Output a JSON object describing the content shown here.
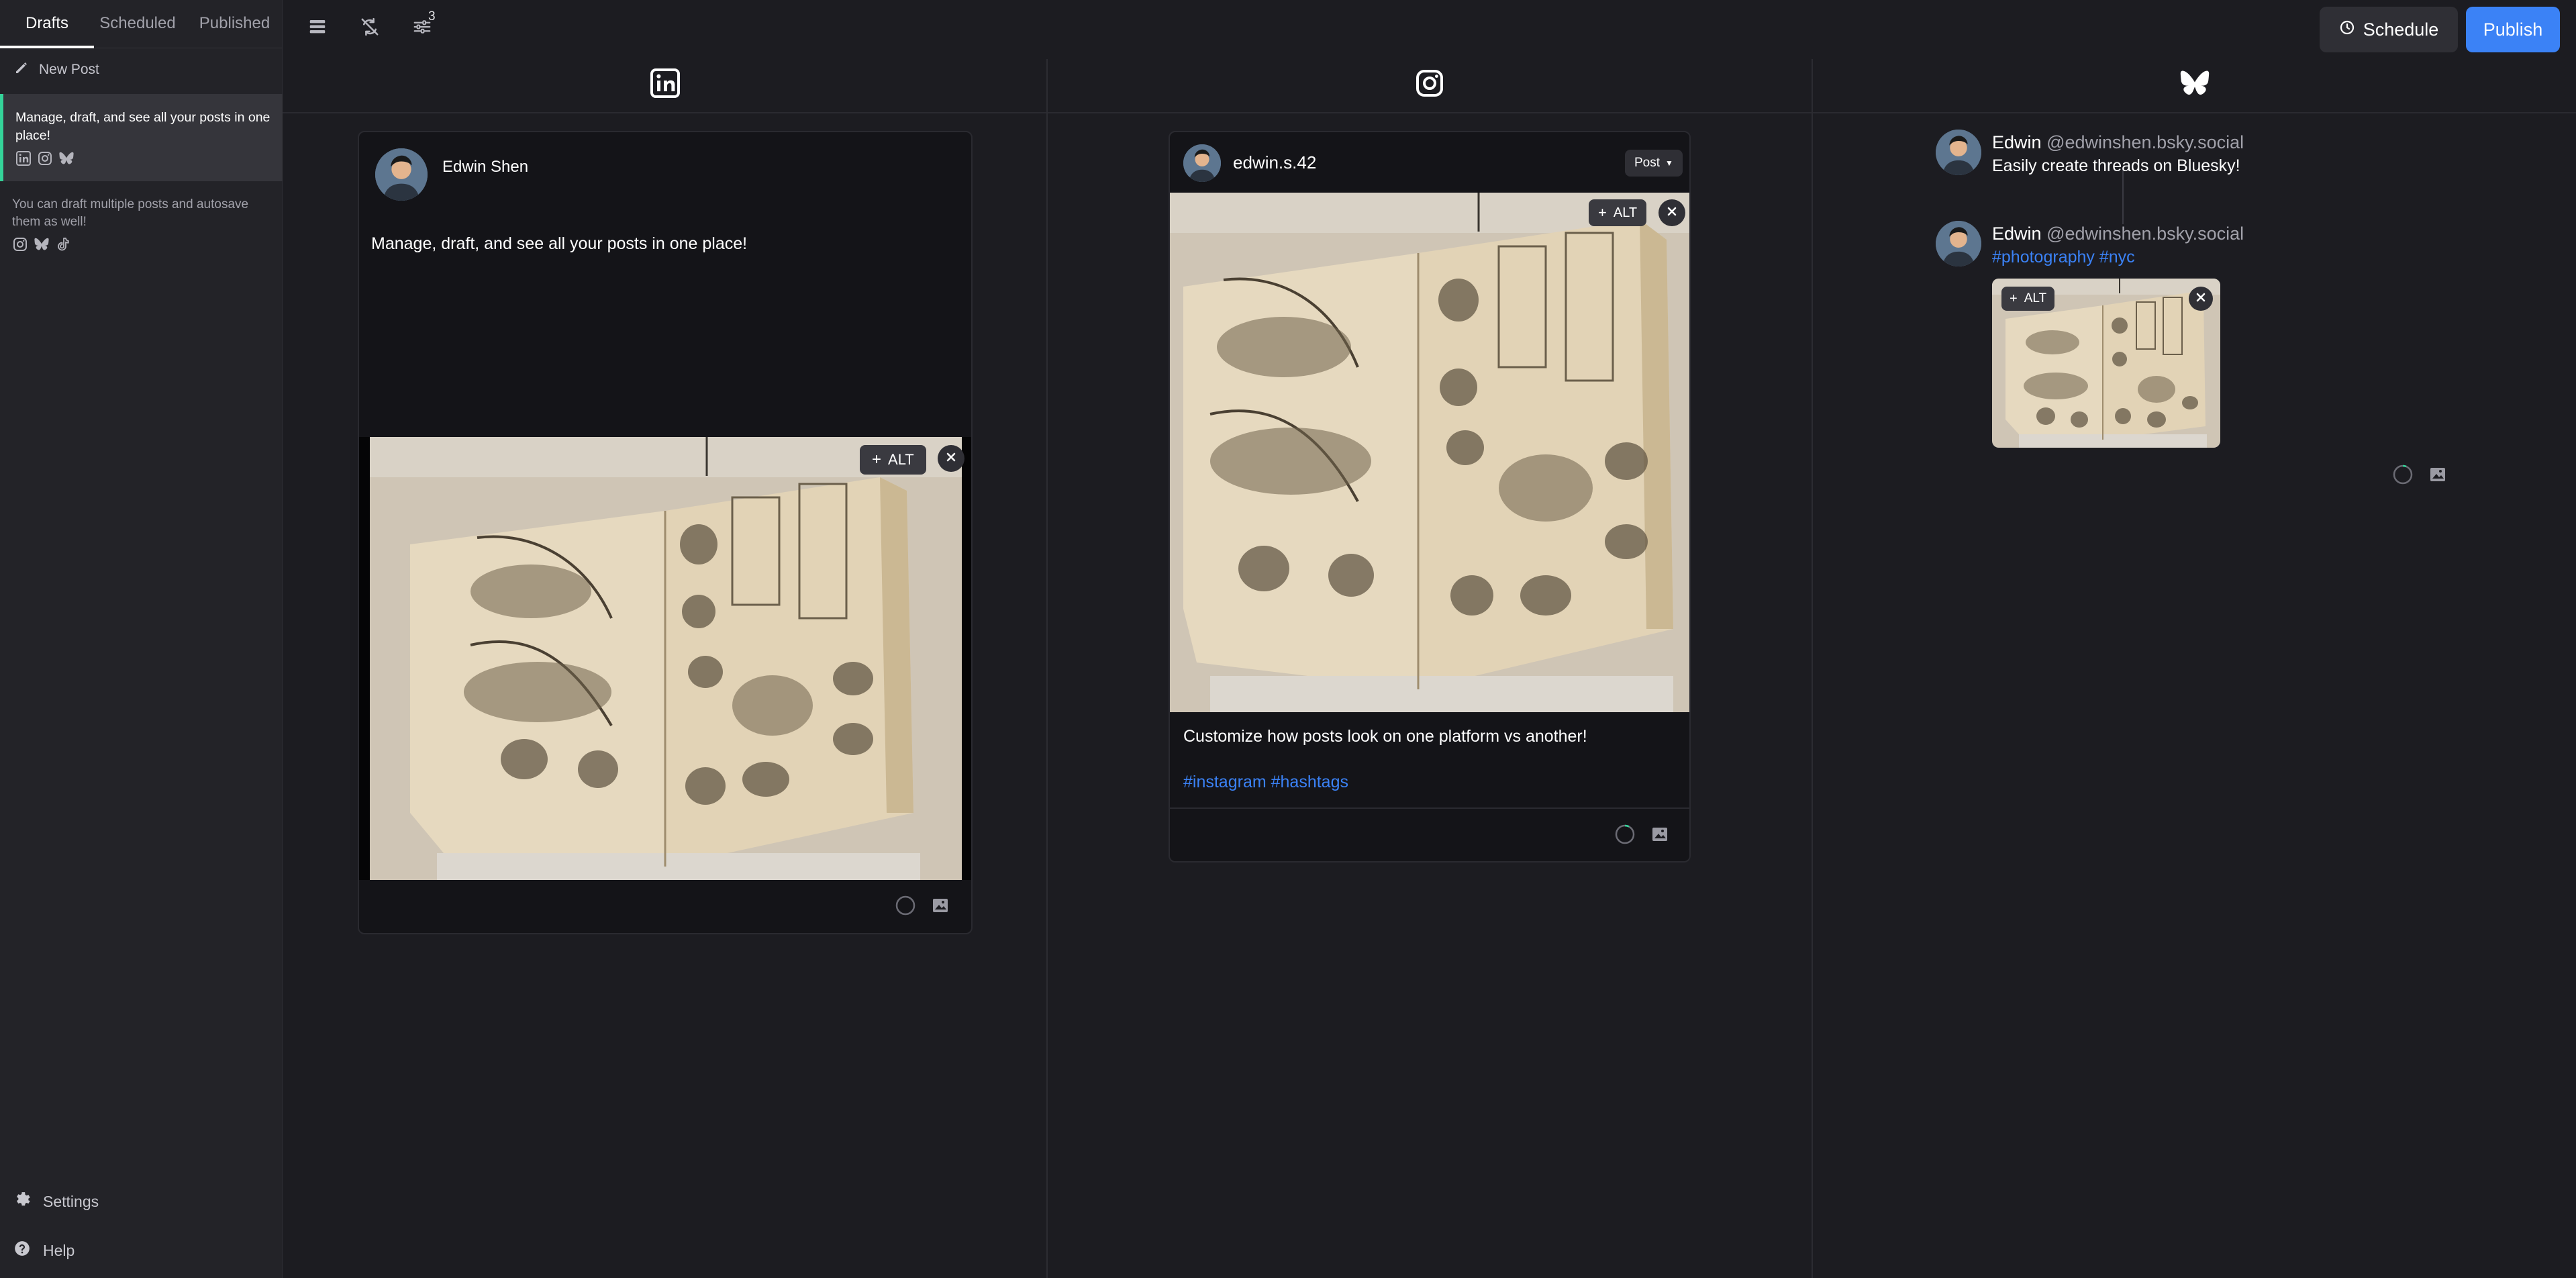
{
  "sidebar": {
    "tabs": [
      "Drafts",
      "Scheduled",
      "Published"
    ],
    "new_post_label": "New Post",
    "drafts": [
      {
        "text": "Manage, draft, and see all your posts in one place!",
        "platforms": [
          "linkedin-icon",
          "instagram-icon",
          "bluesky-icon"
        ]
      },
      {
        "text": "You can draft multiple posts and autosave them as well!",
        "platforms": [
          "instagram-icon",
          "bluesky-icon",
          "tiktok-icon"
        ]
      }
    ],
    "settings_label": "Settings",
    "help_label": "Help"
  },
  "toolbar": {
    "filter_count": "3",
    "schedule_label": "Schedule",
    "publish_label": "Publish"
  },
  "linkedin": {
    "author": "Edwin Shen",
    "body": "Manage, draft, and see all your posts in one place!",
    "alt_label": "ALT"
  },
  "instagram": {
    "handle": "edwin.s.42",
    "post_type": "Post",
    "alt_label": "ALT",
    "caption": "Customize how posts look on one platform vs another!",
    "hashtags": "#instagram #hashtags"
  },
  "bluesky": {
    "posts": [
      {
        "name": "Edwin",
        "handle": "@edwinshen.bsky.social",
        "text": "Easily create threads on Bluesky!"
      },
      {
        "name": "Edwin",
        "handle": "@edwinshen.bsky.social",
        "text": "#photography #nyc"
      }
    ],
    "alt_label": "ALT"
  },
  "colors": {
    "accent": "#3b82f6",
    "selected_bar": "#34d399",
    "background": "#1c1c21"
  }
}
